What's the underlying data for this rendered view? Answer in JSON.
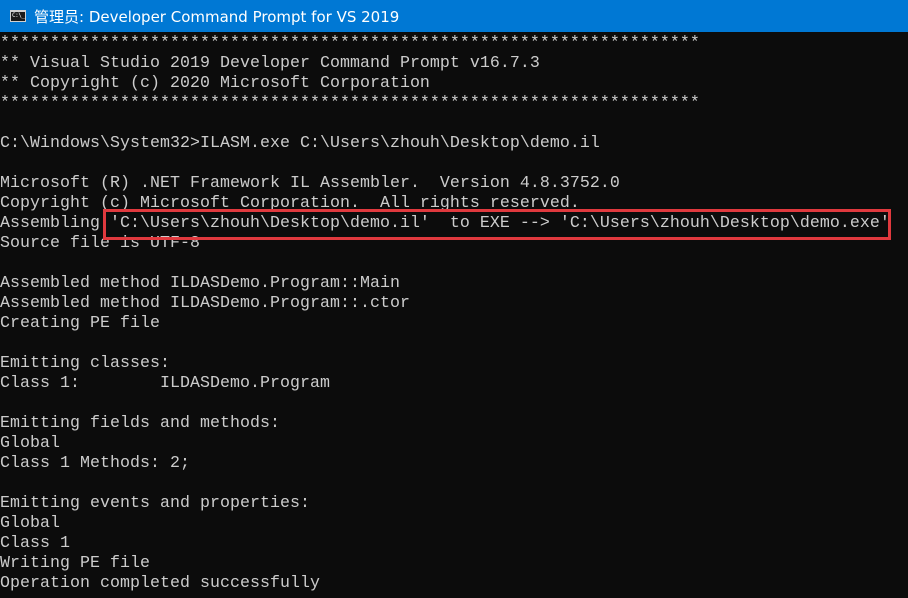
{
  "window": {
    "title": "管理员: Developer Command Prompt for VS 2019",
    "icon": "cmd-icon",
    "icon_text": "C:\\_"
  },
  "console": {
    "lines": [
      "**********************************************************************",
      "** Visual Studio 2019 Developer Command Prompt v16.7.3",
      "** Copyright (c) 2020 Microsoft Corporation",
      "**********************************************************************",
      "",
      "C:\\Windows\\System32>ILASM.exe C:\\Users\\zhouh\\Desktop\\demo.il",
      "",
      "Microsoft (R) .NET Framework IL Assembler.  Version 4.8.3752.0",
      "Copyright (c) Microsoft Corporation.  All rights reserved.",
      "Assembling 'C:\\Users\\zhouh\\Desktop\\demo.il'  to EXE --> 'C:\\Users\\zhouh\\Desktop\\demo.exe'",
      "Source file is UTF-8",
      "",
      "Assembled method ILDASDemo.Program::Main",
      "Assembled method ILDASDemo.Program::.ctor",
      "Creating PE file",
      "",
      "Emitting classes:",
      "Class 1:        ILDASDemo.Program",
      "",
      "Emitting fields and methods:",
      "Global",
      "Class 1 Methods: 2;",
      "",
      "Emitting events and properties:",
      "Global",
      "Class 1",
      "Writing PE file",
      "Operation completed successfully"
    ]
  },
  "annotation": {
    "highlighted_text": "'C:\\Users\\zhouh\\Desktop\\demo.il'  to EXE --> 'C:\\Users\\zhouh\\Desktop\\demo.exe'",
    "color": "#e0393e"
  },
  "colors": {
    "titlebar": "#0078d4",
    "background": "#0c0c0c",
    "foreground": "#cccccc"
  }
}
